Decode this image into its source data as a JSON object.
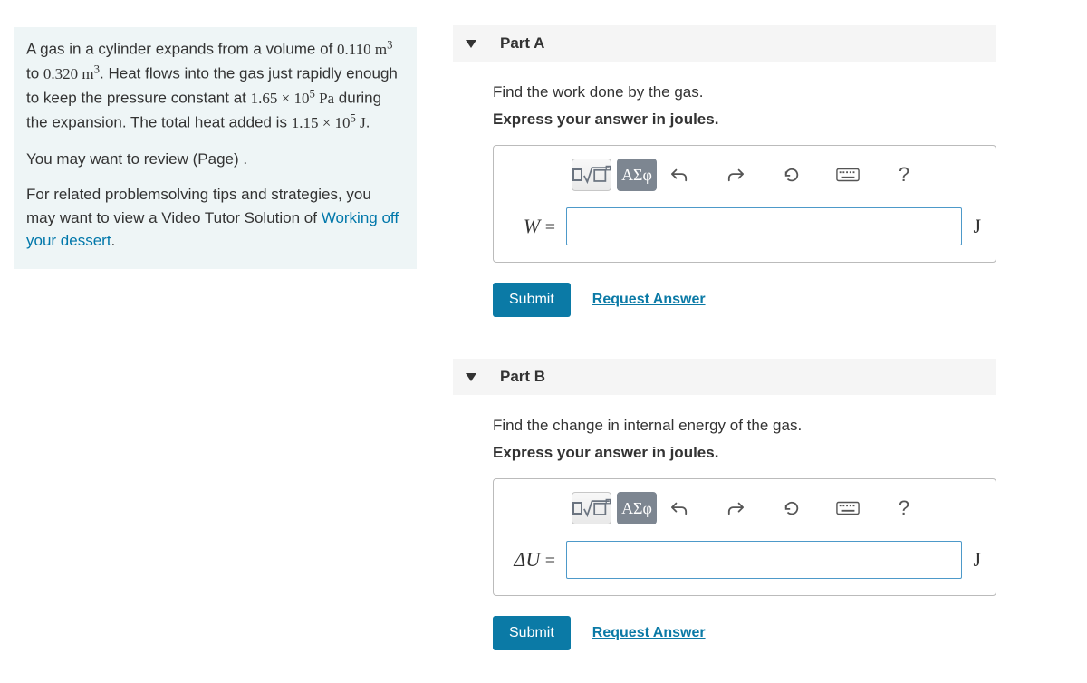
{
  "problem": {
    "text_html": "A gas in a cylinder expands from a volume of <span class='serif'>0.110 m<sup>3</sup></span> to <span class='serif'>0.320 m<sup>3</sup></span>. Heat flows into the gas just rapidly enough to keep the pressure constant at <span class='serif'>1.65 × 10<sup>5</sup> Pa</span> during the expansion. The total heat added is <span class='serif'>1.15 × 10<sup>5</sup> J</span>.",
    "review_line": "You may want to review (Page) .",
    "related_prefix": "For related problemsolving tips and strategies, you may want to view a Video Tutor Solution of ",
    "related_link": "Working off your dessert",
    "related_suffix": "."
  },
  "partA": {
    "title": "Part A",
    "question": "Find the work done by the gas.",
    "instruction": "Express your answer in joules.",
    "var_label": "W",
    "unit": "J",
    "submit": "Submit",
    "request": "Request Answer",
    "greek_label": "ΑΣφ",
    "help_label": "?"
  },
  "partB": {
    "title": "Part B",
    "question": "Find the change in internal energy of the gas.",
    "instruction": "Express your answer in joules.",
    "var_label": "ΔU",
    "unit": "J",
    "submit": "Submit",
    "request": "Request Answer",
    "greek_label": "ΑΣφ",
    "help_label": "?"
  }
}
